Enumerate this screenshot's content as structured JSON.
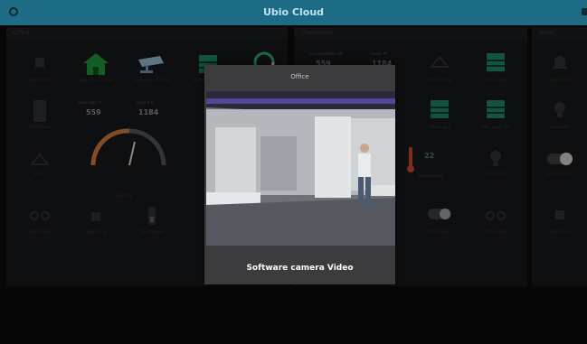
{
  "app": {
    "title": "Ubio Cloud"
  },
  "panels": {
    "left": {
      "header": "Office",
      "tiles": [
        "Ubio Office",
        "Ubio Cloud House",
        "Software camera",
        "Software Light",
        "Ubio Door",
        "Humidity",
        "Aircon",
        "Ubio Lamp",
        "Ubio Relay",
        "Ubio Socket",
        "Ubio Switch"
      ],
      "readings": [
        {
          "label": "Humidity %",
          "value": "559"
        },
        {
          "label": "Sound lx",
          "value": "1184"
        }
      ]
    },
    "right": {
      "header": "Thermostat",
      "readings": [
        {
          "label": "Consumption W",
          "value": "559"
        },
        {
          "label": "Power W",
          "value": "1184"
        }
      ],
      "temperature": "22",
      "tiles": [
        "Thermostat",
        "Ubio Light",
        "Ubio Light",
        "Ubio Light Tab",
        "Temperature",
        "Ubio Bulb",
        "Ubio Switch",
        "Ubio Light"
      ]
    },
    "alarm": {
      "header": "Alarm",
      "tiles": [
        "Ubio Alarm",
        "Ubio Light",
        "Ubio Sensor",
        "Ubio Relay"
      ]
    }
  },
  "dialog": {
    "title": "Office",
    "caption": "Software camera Video"
  }
}
